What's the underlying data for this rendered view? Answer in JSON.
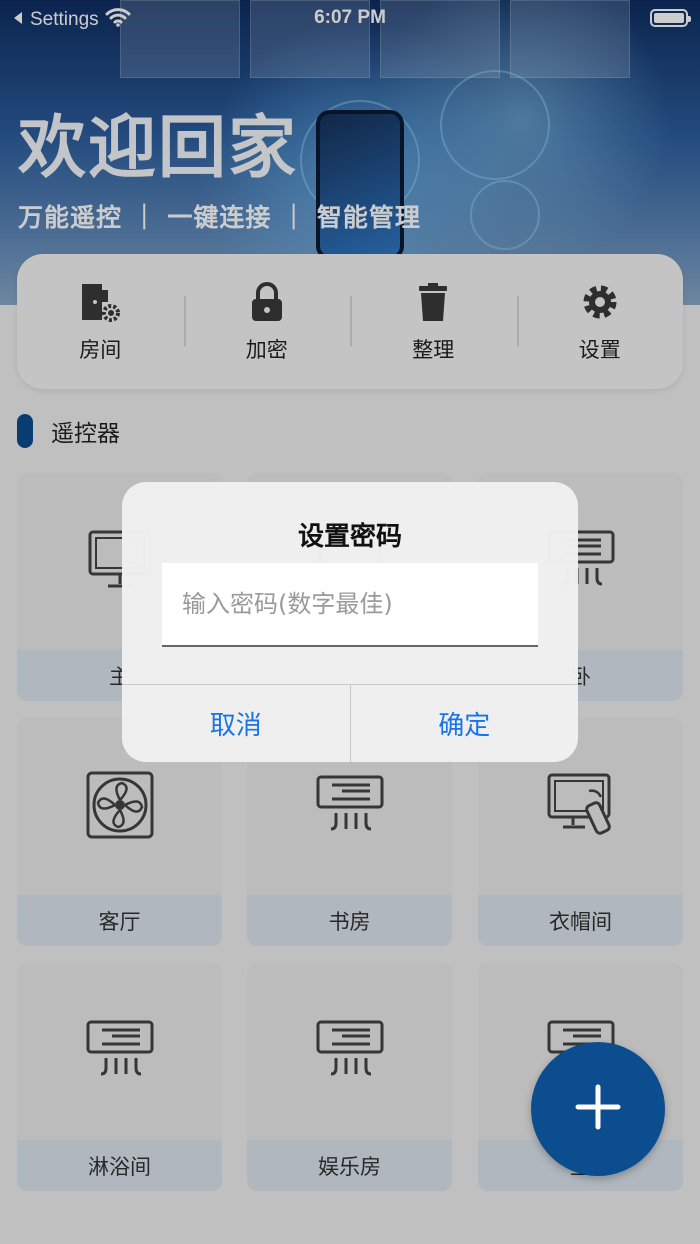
{
  "status_bar": {
    "back_label": "Settings",
    "time": "6:07 PM"
  },
  "hero": {
    "title": "欢迎回家",
    "subtitle": "万能遥控 ｜ 一键连接 ｜ 智能管理"
  },
  "toolbar": {
    "items": [
      {
        "label": "房间",
        "icon": "room-settings-icon"
      },
      {
        "label": "加密",
        "icon": "lock-icon"
      },
      {
        "label": "整理",
        "icon": "trash-icon"
      },
      {
        "label": "设置",
        "icon": "gear-icon"
      }
    ]
  },
  "section": {
    "title": "遥控器"
  },
  "cards": [
    {
      "label": "主",
      "icon": "monitor-icon"
    },
    {
      "label": "",
      "icon": "monitor-icon"
    },
    {
      "label": "卧",
      "icon": "air-conditioner-icon"
    },
    {
      "label": "客厅",
      "icon": "fan-icon"
    },
    {
      "label": "书房",
      "icon": "air-conditioner-icon"
    },
    {
      "label": "衣帽间",
      "icon": "tv-remote-icon"
    },
    {
      "label": "淋浴间",
      "icon": "air-conditioner-icon"
    },
    {
      "label": "娱乐房",
      "icon": "air-conditioner-icon"
    },
    {
      "label": "主",
      "icon": "air-conditioner-icon"
    }
  ],
  "dialog": {
    "title": "设置密码",
    "input_placeholder": "输入密码(数字最佳)",
    "input_value": "",
    "cancel_label": "取消",
    "confirm_label": "确定"
  },
  "fab": {
    "icon": "plus-icon"
  },
  "colors": {
    "accent": "#0c4d8f",
    "dialog_button": "#1a73e8",
    "card_label_bg": "#dde5ee"
  }
}
